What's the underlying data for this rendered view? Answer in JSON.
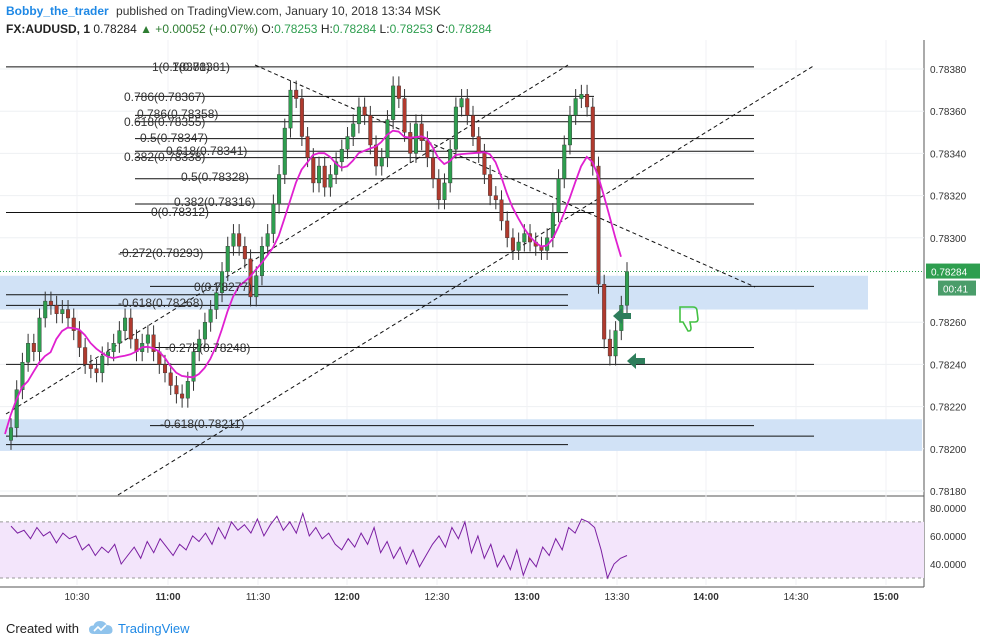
{
  "header": {
    "author": "Bobby_the_trader",
    "published_text": "published on TradingView.com, January 10, 2018 13:34 MSK",
    "symbol": "FX:AUDUSD, 1",
    "last": "0.78284",
    "change": "▲ +0.00052 (+0.07%)",
    "o_label": "O:",
    "o": "0.78253",
    "h_label": "H:",
    "h": "0.78284",
    "l_label": "L:",
    "l": "0.78253",
    "c_label": "C:",
    "c": "0.78284"
  },
  "footer": {
    "created_with": "Created with",
    "brand": "TradingView"
  },
  "colors": {
    "candle_up": "#2e9e4f",
    "candle_down": "#b03a2e",
    "ma_line": "#e020d0",
    "rsi_line": "#7b1fa2",
    "zone": "#cfe0f6",
    "rsi_band": "#f3e5fb",
    "thumb_down": "#43c143",
    "arrow": "#2e7d5b"
  },
  "chart_data": [
    {
      "type": "candlestick",
      "title": "",
      "x_ticks": [
        "10:30",
        "11:00",
        "11:30",
        "12:00",
        "12:30",
        "13:00",
        "13:30",
        "14:00",
        "14:30",
        "15:00"
      ],
      "y_ticks": [
        "0.78380",
        "0.78360",
        "0.78340",
        "0.78320",
        "0.78300",
        "0.78260",
        "0.78240",
        "0.78220",
        "0.78200",
        "0.78180"
      ],
      "ylim": [
        0.7817,
        0.7839
      ],
      "last_price_label": "0.78284",
      "countdown_label": "00:41",
      "closes": [
        0.7821,
        0.78228,
        0.78241,
        0.7825,
        0.78246,
        0.78262,
        0.7827,
        0.78268,
        0.78264,
        0.78266,
        0.78262,
        0.78256,
        0.78248,
        0.7824,
        0.78238,
        0.78236,
        0.78244,
        0.78246,
        0.7825,
        0.78256,
        0.78262,
        0.78252,
        0.78246,
        0.7825,
        0.78254,
        0.78246,
        0.7824,
        0.78236,
        0.7823,
        0.78226,
        0.78224,
        0.78232,
        0.78246,
        0.78252,
        0.7826,
        0.78266,
        0.78274,
        0.78284,
        0.78296,
        0.78302,
        0.78296,
        0.7829,
        0.78272,
        0.78282,
        0.78296,
        0.78302,
        0.78316,
        0.7833,
        0.78352,
        0.7837,
        0.78366,
        0.78348,
        0.78338,
        0.78326,
        0.78334,
        0.78324,
        0.7833,
        0.78336,
        0.78342,
        0.78348,
        0.78354,
        0.78362,
        0.78358,
        0.78344,
        0.78334,
        0.78338,
        0.78356,
        0.78372,
        0.78366,
        0.7835,
        0.7834,
        0.78354,
        0.78346,
        0.78338,
        0.78328,
        0.78318,
        0.78326,
        0.78342,
        0.78362,
        0.78366,
        0.78358,
        0.78348,
        0.7834,
        0.7833,
        0.7832,
        0.78318,
        0.78308,
        0.783,
        0.78294,
        0.78298,
        0.78302,
        0.78298,
        0.78296,
        0.78294,
        0.783,
        0.78312,
        0.78328,
        0.78344,
        0.78358,
        0.78366,
        0.78368,
        0.78362,
        0.78334,
        0.78278,
        0.78252,
        0.78244,
        0.78256,
        0.78268,
        0.78284
      ],
      "ma_series_name": "",
      "fib_labels": [
        "1(0.78381)",
        "1(0.78381)",
        "0.786(0.78367)",
        "0.786(0.78358)",
        "0.618(0.78355)",
        "0.5(0.78347)",
        "0.618(0.78341)",
        "0.382(0.78338)",
        "0.5(0.78328)",
        "0.382(0.78316)",
        "0(0.78312)",
        "-0.272(0.78293)",
        "0(0.78277)",
        "-0.618(0.78268)",
        "-0.272(0.78248)",
        "-0.618(0.78211)"
      ],
      "fib_levels": [
        0.78381,
        0.78367,
        0.78358,
        0.78355,
        0.78347,
        0.78341,
        0.78338,
        0.78328,
        0.78316,
        0.78312,
        0.78293,
        0.78277,
        0.78273,
        0.78268,
        0.78248,
        0.7824,
        0.78211,
        0.78206,
        0.78202
      ],
      "zones": [
        [
          0.78266,
          0.78282
        ],
        [
          0.78199,
          0.78214
        ]
      ]
    },
    {
      "type": "line",
      "title": "",
      "ylim": [
        25,
        87
      ],
      "y_ticks": [
        "80.0000",
        "60.0000",
        "40.0000"
      ],
      "band": [
        30,
        70
      ],
      "values": [
        67,
        62,
        64,
        58,
        66,
        60,
        63,
        55,
        62,
        58,
        60,
        50,
        54,
        46,
        52,
        48,
        54,
        40,
        46,
        52,
        44,
        56,
        48,
        58,
        52,
        46,
        54,
        50,
        60,
        56,
        62,
        54,
        66,
        58,
        70,
        64,
        68,
        62,
        72,
        60,
        68,
        74,
        64,
        70,
        62,
        76,
        60,
        66,
        58,
        62,
        54,
        50,
        58,
        52,
        62,
        54,
        66,
        48,
        56,
        44,
        52,
        40,
        50,
        38,
        46,
        54,
        60,
        52,
        66,
        58,
        70,
        48,
        60,
        44,
        54,
        38,
        46,
        36,
        50,
        32,
        44,
        38,
        52,
        46,
        58,
        50,
        66,
        62,
        72,
        70,
        66,
        50,
        30,
        40,
        44,
        46
      ],
      "values_note": ""
    }
  ]
}
